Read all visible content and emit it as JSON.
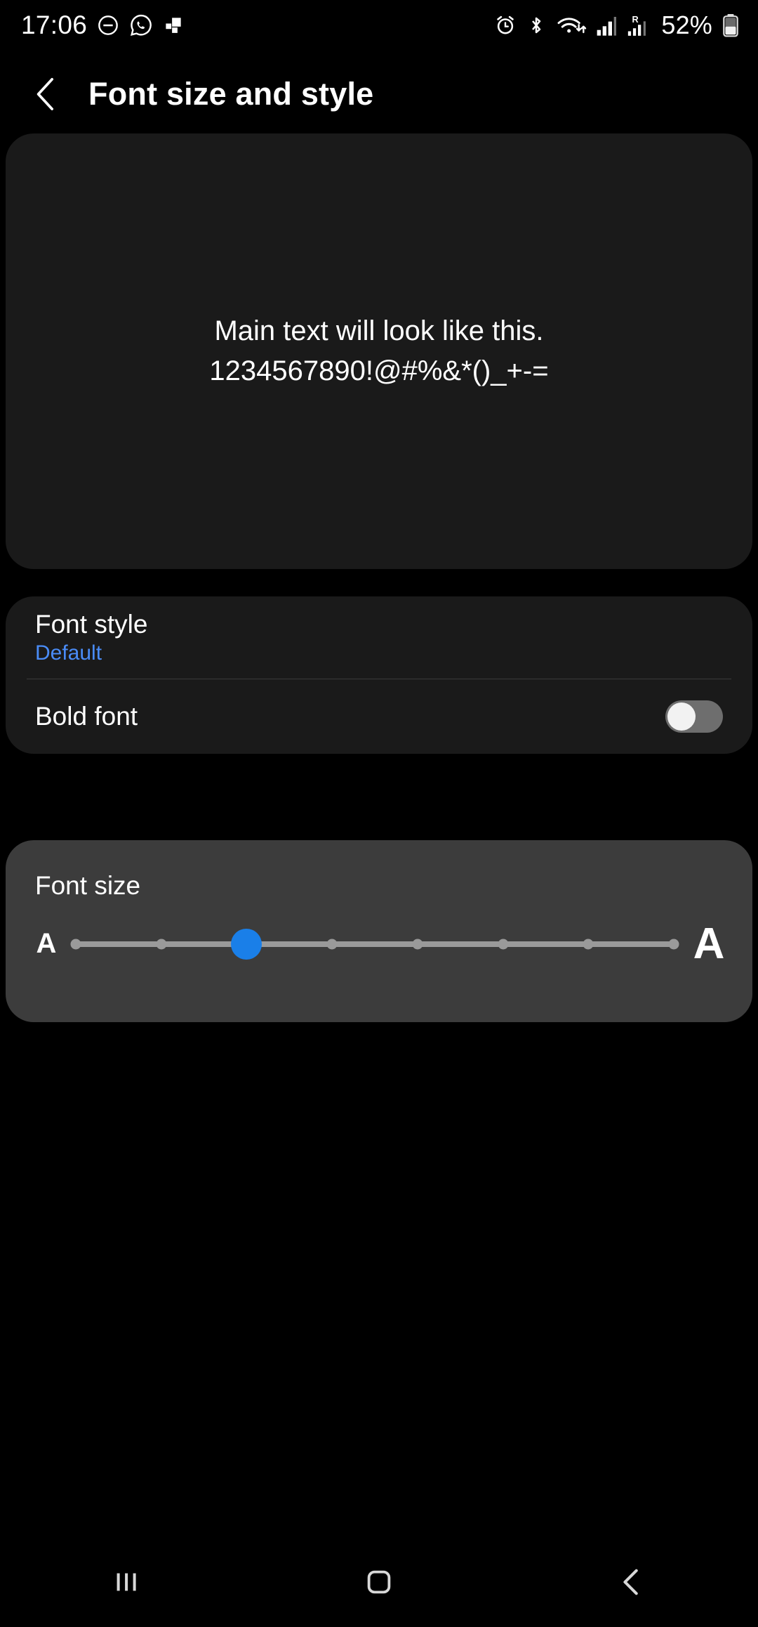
{
  "status_bar": {
    "time": "17:06",
    "battery_percent": "52%",
    "left_icons": [
      {
        "name": "do-not-disturb-icon"
      },
      {
        "name": "whatsapp-icon"
      },
      {
        "name": "app-notification-icon"
      }
    ],
    "right_icons": [
      {
        "name": "alarm-icon"
      },
      {
        "name": "bluetooth-icon"
      },
      {
        "name": "wifi-icon"
      },
      {
        "name": "signal-bars-icon"
      },
      {
        "name": "roaming-signal-icon"
      },
      {
        "name": "battery-icon"
      }
    ]
  },
  "header": {
    "back_label": "back-arrow",
    "title": "Font size and style"
  },
  "preview": {
    "line1": "Main text will look like this.",
    "line2": "1234567890!@#%&*()_+-="
  },
  "font_style": {
    "label": "Font style",
    "value": "Default",
    "value_color": "#4a8cf7"
  },
  "bold_font": {
    "label": "Bold font",
    "enabled": false
  },
  "font_size": {
    "label": "Font size",
    "small_a": "A",
    "large_a": "A",
    "steps": 8,
    "current_step": 2
  },
  "nav_bar": {
    "recents_label": "recents-button",
    "home_label": "home-button",
    "back_label": "back-button"
  },
  "colors": {
    "background": "#000000",
    "card": "#1a1a1a",
    "card_highlight": "#3c3c3c",
    "accent": "#1a7fe8",
    "link": "#4a8cf7"
  }
}
